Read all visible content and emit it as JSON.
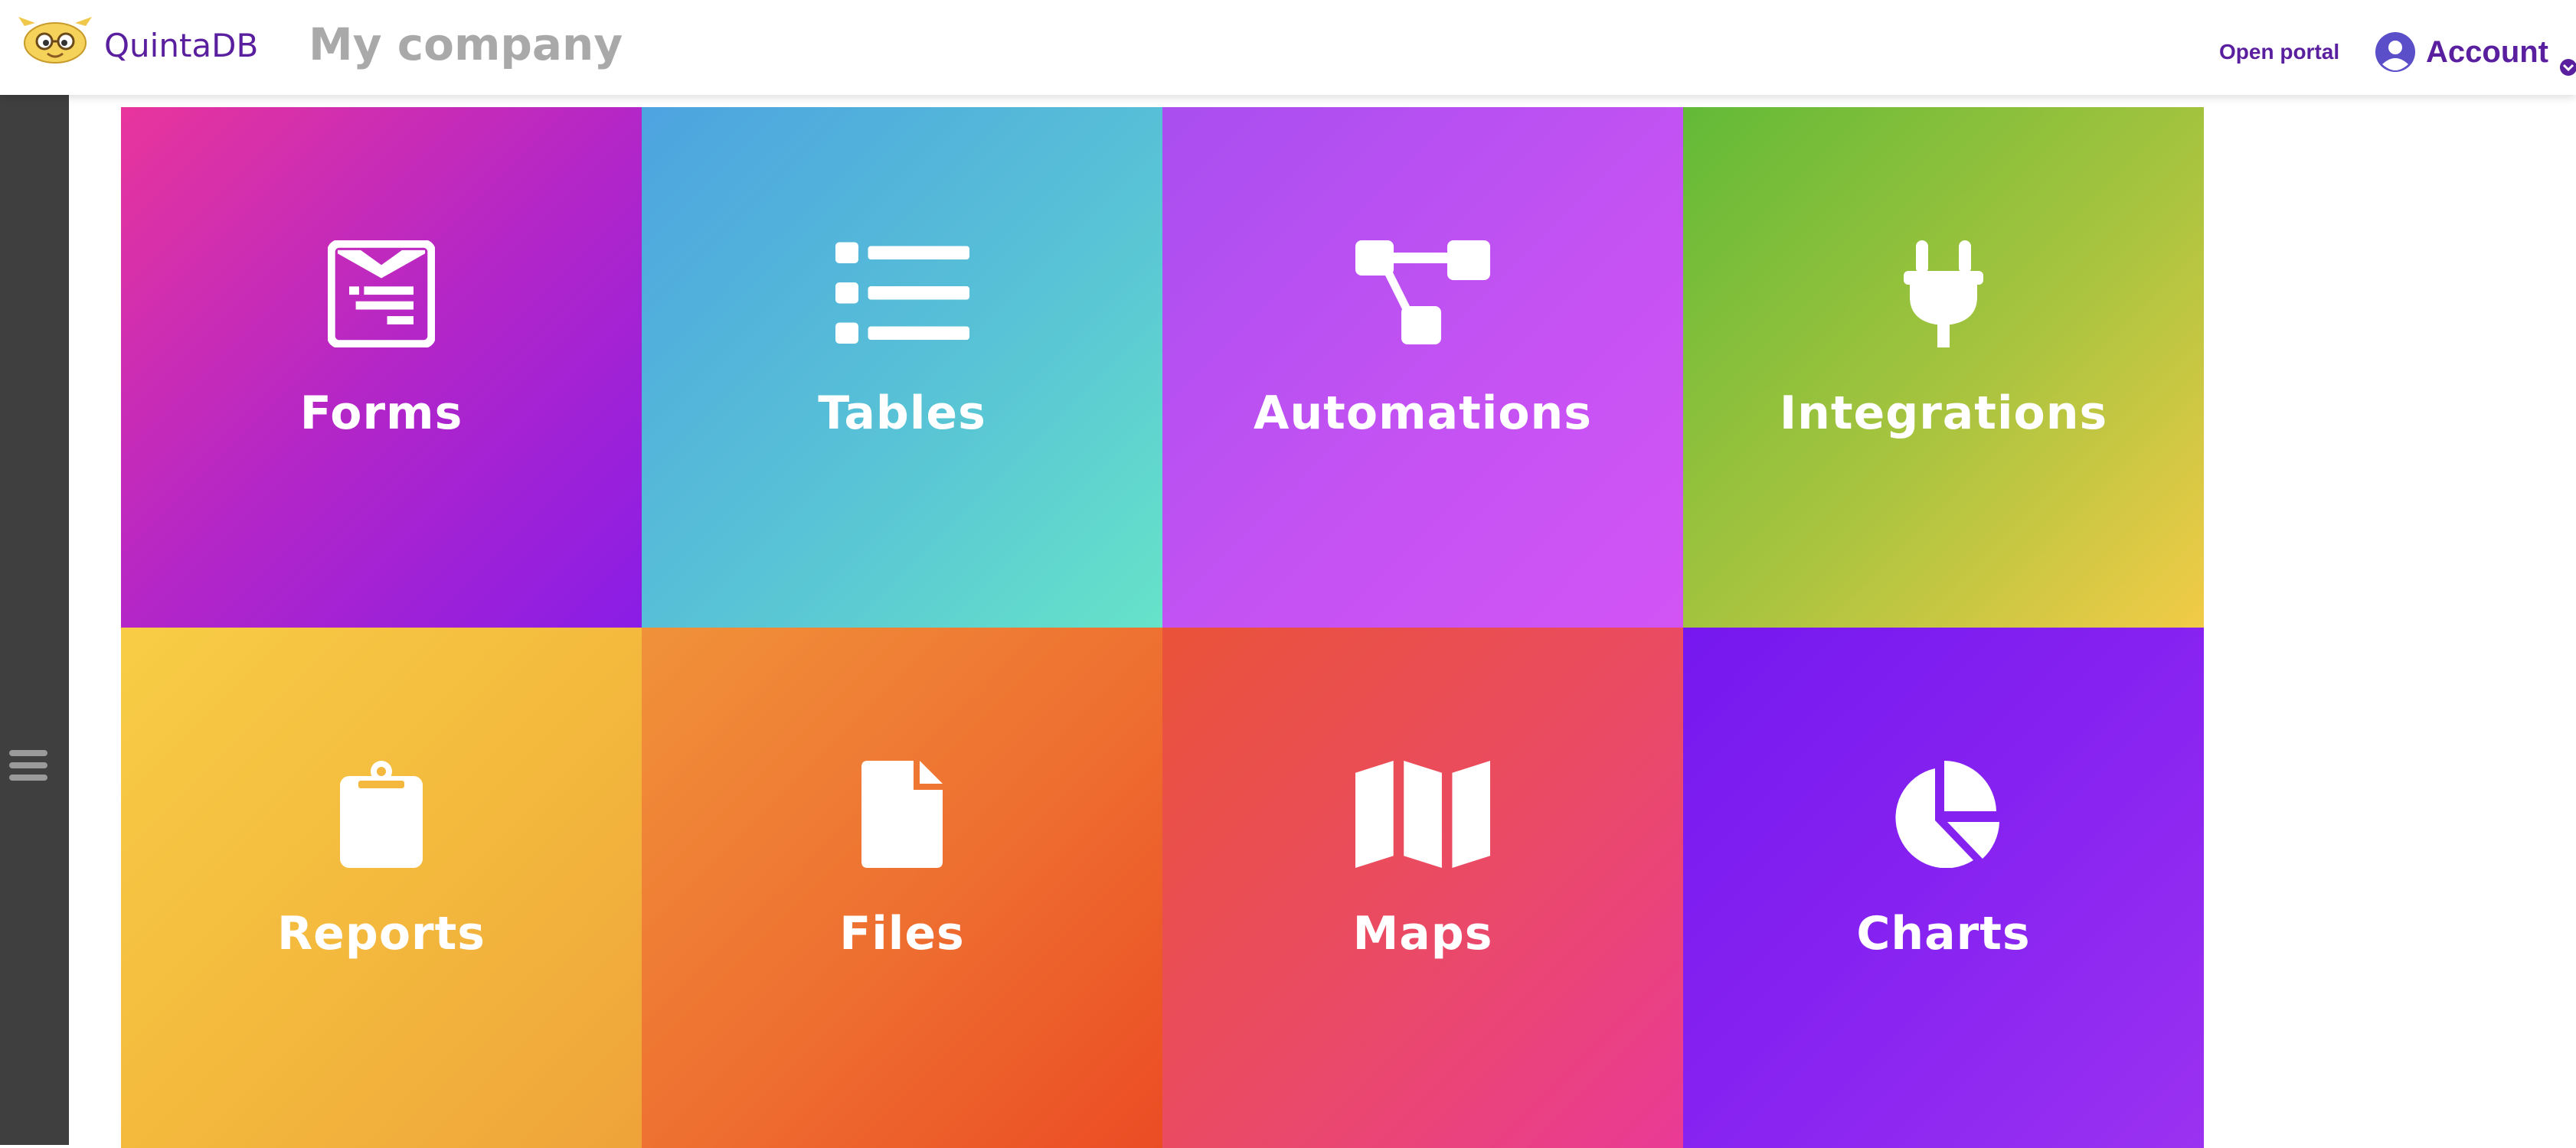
{
  "header": {
    "brand": "QuintaDB",
    "company": "My company",
    "open_portal": "Open portal",
    "account_label": "Account"
  },
  "icons": {
    "logo": "mascot-logo-icon",
    "account": "user-avatar-icon",
    "account_menu": "chevron-down-icon",
    "sidebar_toggle": "hamburger-icon"
  },
  "tiles": [
    {
      "label": "Forms",
      "icon": "form-icon"
    },
    {
      "label": "Tables",
      "icon": "list-icon"
    },
    {
      "label": "Automations",
      "icon": "sitemap-icon"
    },
    {
      "label": "Integrations",
      "icon": "plug-icon"
    },
    {
      "label": "Reports",
      "icon": "clipboard-icon"
    },
    {
      "label": "Files",
      "icon": "file-icon"
    },
    {
      "label": "Maps",
      "icon": "map-icon"
    },
    {
      "label": "Charts",
      "icon": "pie-chart-icon"
    }
  ],
  "colors": {
    "brand": "#5a1f9e",
    "company_text": "#a9a9a9",
    "sidebar": "#3f3f3f"
  }
}
